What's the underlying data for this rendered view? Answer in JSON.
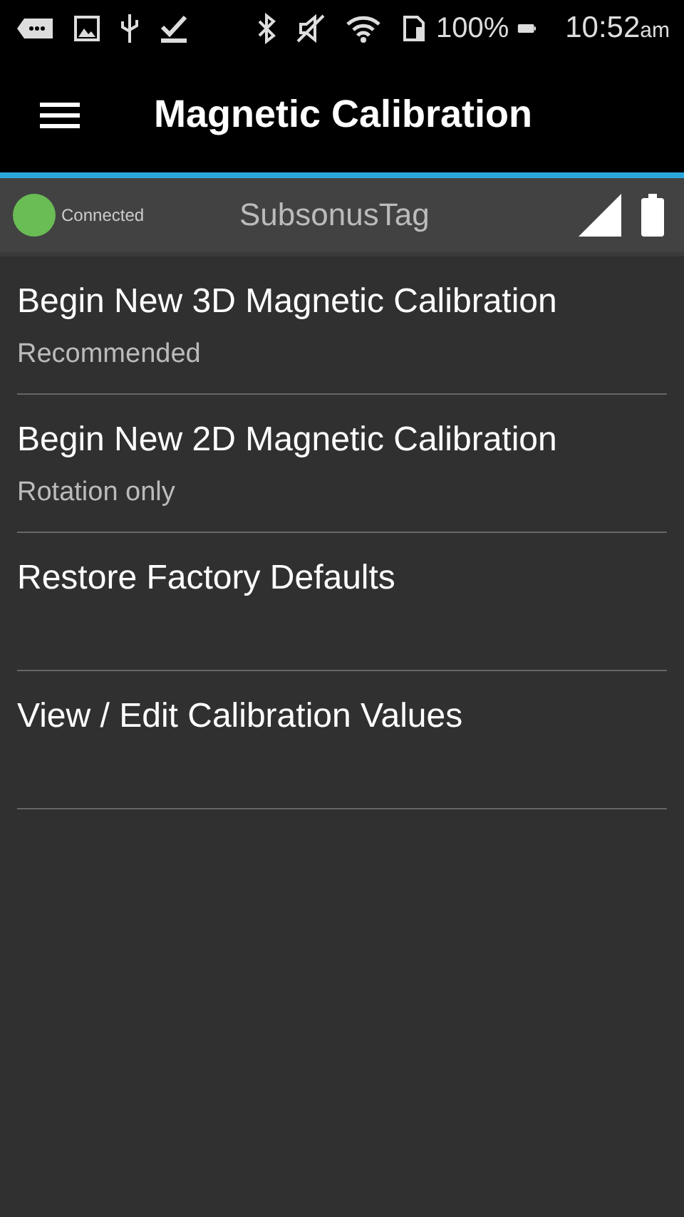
{
  "status_bar": {
    "battery": "100%",
    "time": "10:52",
    "time_suffix": "am"
  },
  "app_bar": {
    "title": "Magnetic Calibration"
  },
  "device_bar": {
    "connected": true,
    "status": "Connected",
    "device_name": "SubsonusTag"
  },
  "menu_items": [
    {
      "title": "Begin New 3D Magnetic Calibration",
      "subtitle": "Recommended"
    },
    {
      "title": "Begin New 2D Magnetic Calibration",
      "subtitle": "Rotation only"
    },
    {
      "title": "Restore Factory Defaults"
    },
    {
      "title": "View / Edit Calibration Values"
    }
  ]
}
